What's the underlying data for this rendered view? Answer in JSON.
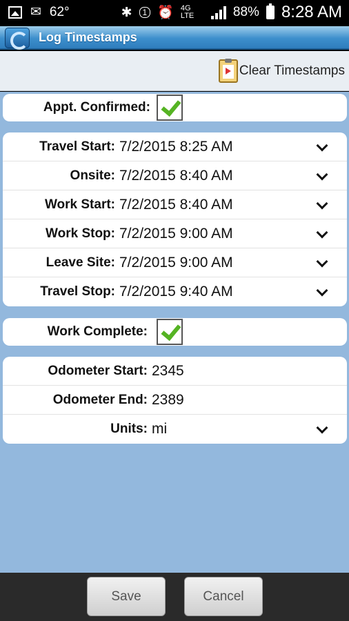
{
  "status_bar": {
    "temperature": "62°",
    "signal_badge": "1",
    "network": "4G LTE",
    "battery": "88%",
    "time": "8:28 AM"
  },
  "app": {
    "title": "Log Timestamps"
  },
  "toolbar": {
    "clear_label": "Clear Timestamps"
  },
  "appt": {
    "label": "Appt. Confirmed:",
    "checked": true
  },
  "timestamps": [
    {
      "label": "Travel Start:",
      "value": "7/2/2015 8:25 AM"
    },
    {
      "label": "Onsite:",
      "value": "7/2/2015 8:40 AM"
    },
    {
      "label": "Work Start:",
      "value": "7/2/2015 8:40 AM"
    },
    {
      "label": "Work Stop:",
      "value": "7/2/2015 9:00 AM"
    },
    {
      "label": "Leave Site:",
      "value": "7/2/2015 9:00 AM"
    },
    {
      "label": "Travel Stop:",
      "value": "7/2/2015 9:40 AM"
    }
  ],
  "work_complete": {
    "label": "Work Complete:",
    "checked": true
  },
  "odometer": {
    "start_label": "Odometer Start:",
    "start_value": "2345",
    "end_label": "Odometer End:",
    "end_value": "2389",
    "units_label": "Units:",
    "units_value": "mi"
  },
  "buttons": {
    "save": "Save",
    "cancel": "Cancel"
  },
  "colors": {
    "background": "#93b8dd",
    "title_bar": "#3d8fcc",
    "check": "#55b323"
  }
}
